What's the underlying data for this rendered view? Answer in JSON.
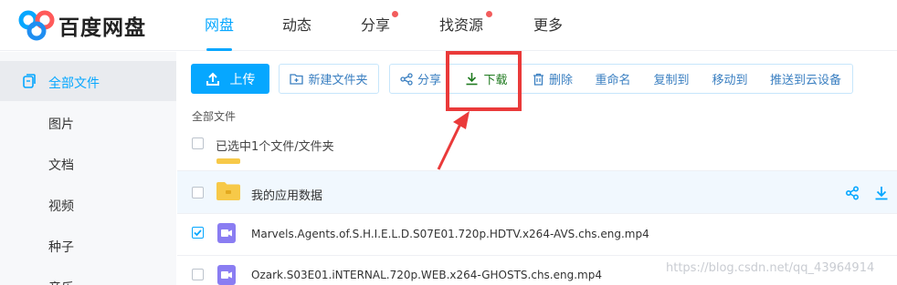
{
  "brand": "百度网盘",
  "nav": [
    "网盘",
    "动态",
    "分享",
    "找资源",
    "更多"
  ],
  "sidebar": {
    "items": [
      "全部文件",
      "图片",
      "文档",
      "视频",
      "种子",
      "音乐"
    ]
  },
  "toolbar": {
    "upload": "上传",
    "new_folder": "新建文件夹",
    "share": "分享",
    "download": "下载",
    "delete": "删除",
    "rename": "重命名",
    "copy_to": "复制到",
    "move_to": "移动到",
    "push_to_cloud": "推送到云设备"
  },
  "breadcrumb": "全部文件",
  "selection_info": "已选中1个文件/文件夹",
  "files": [
    {
      "name": "我的应用数据",
      "type": "folder",
      "checked": false
    },
    {
      "name": "Marvels.Agents.of.S.H.I.E.L.D.S07E01.720p.HDTV.x264-AVS.chs.eng.mp4",
      "type": "video",
      "checked": true
    },
    {
      "name": "Ozark.S03E01.iNTERNAL.720p.WEB.x264-GHOSTS.chs.eng.mp4",
      "type": "video",
      "checked": false
    }
  ],
  "watermark": "https://blog.csdn.net/qq_43964914",
  "colors": {
    "accent": "#06a7ff",
    "highlight": "#ea3a3a",
    "badge": "#f25c5c"
  }
}
